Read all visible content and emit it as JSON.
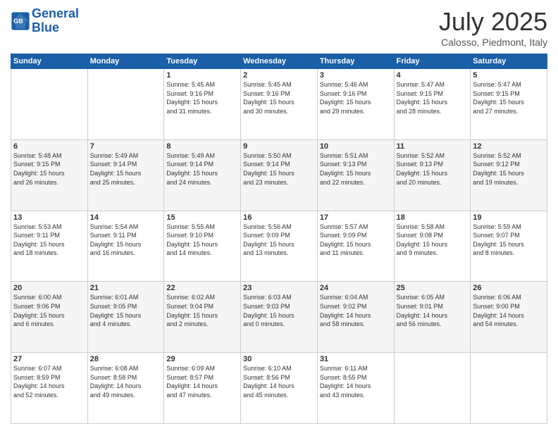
{
  "header": {
    "logo_line1": "General",
    "logo_line2": "Blue",
    "month": "July 2025",
    "location": "Calosso, Piedmont, Italy"
  },
  "weekdays": [
    "Sunday",
    "Monday",
    "Tuesday",
    "Wednesday",
    "Thursday",
    "Friday",
    "Saturday"
  ],
  "weeks": [
    [
      {
        "day": "",
        "info": ""
      },
      {
        "day": "",
        "info": ""
      },
      {
        "day": "1",
        "info": "Sunrise: 5:45 AM\nSunset: 9:16 PM\nDaylight: 15 hours\nand 31 minutes."
      },
      {
        "day": "2",
        "info": "Sunrise: 5:45 AM\nSunset: 9:16 PM\nDaylight: 15 hours\nand 30 minutes."
      },
      {
        "day": "3",
        "info": "Sunrise: 5:46 AM\nSunset: 9:16 PM\nDaylight: 15 hours\nand 29 minutes."
      },
      {
        "day": "4",
        "info": "Sunrise: 5:47 AM\nSunset: 9:15 PM\nDaylight: 15 hours\nand 28 minutes."
      },
      {
        "day": "5",
        "info": "Sunrise: 5:47 AM\nSunset: 9:15 PM\nDaylight: 15 hours\nand 27 minutes."
      }
    ],
    [
      {
        "day": "6",
        "info": "Sunrise: 5:48 AM\nSunset: 9:15 PM\nDaylight: 15 hours\nand 26 minutes."
      },
      {
        "day": "7",
        "info": "Sunrise: 5:49 AM\nSunset: 9:14 PM\nDaylight: 15 hours\nand 25 minutes."
      },
      {
        "day": "8",
        "info": "Sunrise: 5:49 AM\nSunset: 9:14 PM\nDaylight: 15 hours\nand 24 minutes."
      },
      {
        "day": "9",
        "info": "Sunrise: 5:50 AM\nSunset: 9:14 PM\nDaylight: 15 hours\nand 23 minutes."
      },
      {
        "day": "10",
        "info": "Sunrise: 5:51 AM\nSunset: 9:13 PM\nDaylight: 15 hours\nand 22 minutes."
      },
      {
        "day": "11",
        "info": "Sunrise: 5:52 AM\nSunset: 9:13 PM\nDaylight: 15 hours\nand 20 minutes."
      },
      {
        "day": "12",
        "info": "Sunrise: 5:52 AM\nSunset: 9:12 PM\nDaylight: 15 hours\nand 19 minutes."
      }
    ],
    [
      {
        "day": "13",
        "info": "Sunrise: 5:53 AM\nSunset: 9:11 PM\nDaylight: 15 hours\nand 18 minutes."
      },
      {
        "day": "14",
        "info": "Sunrise: 5:54 AM\nSunset: 9:11 PM\nDaylight: 15 hours\nand 16 minutes."
      },
      {
        "day": "15",
        "info": "Sunrise: 5:55 AM\nSunset: 9:10 PM\nDaylight: 15 hours\nand 14 minutes."
      },
      {
        "day": "16",
        "info": "Sunrise: 5:56 AM\nSunset: 9:09 PM\nDaylight: 15 hours\nand 13 minutes."
      },
      {
        "day": "17",
        "info": "Sunrise: 5:57 AM\nSunset: 9:09 PM\nDaylight: 15 hours\nand 11 minutes."
      },
      {
        "day": "18",
        "info": "Sunrise: 5:58 AM\nSunset: 9:08 PM\nDaylight: 15 hours\nand 9 minutes."
      },
      {
        "day": "19",
        "info": "Sunrise: 5:59 AM\nSunset: 9:07 PM\nDaylight: 15 hours\nand 8 minutes."
      }
    ],
    [
      {
        "day": "20",
        "info": "Sunrise: 6:00 AM\nSunset: 9:06 PM\nDaylight: 15 hours\nand 6 minutes."
      },
      {
        "day": "21",
        "info": "Sunrise: 6:01 AM\nSunset: 9:05 PM\nDaylight: 15 hours\nand 4 minutes."
      },
      {
        "day": "22",
        "info": "Sunrise: 6:02 AM\nSunset: 9:04 PM\nDaylight: 15 hours\nand 2 minutes."
      },
      {
        "day": "23",
        "info": "Sunrise: 6:03 AM\nSunset: 9:03 PM\nDaylight: 15 hours\nand 0 minutes."
      },
      {
        "day": "24",
        "info": "Sunrise: 6:04 AM\nSunset: 9:02 PM\nDaylight: 14 hours\nand 58 minutes."
      },
      {
        "day": "25",
        "info": "Sunrise: 6:05 AM\nSunset: 9:01 PM\nDaylight: 14 hours\nand 56 minutes."
      },
      {
        "day": "26",
        "info": "Sunrise: 6:06 AM\nSunset: 9:00 PM\nDaylight: 14 hours\nand 54 minutes."
      }
    ],
    [
      {
        "day": "27",
        "info": "Sunrise: 6:07 AM\nSunset: 8:59 PM\nDaylight: 14 hours\nand 52 minutes."
      },
      {
        "day": "28",
        "info": "Sunrise: 6:08 AM\nSunset: 8:58 PM\nDaylight: 14 hours\nand 49 minutes."
      },
      {
        "day": "29",
        "info": "Sunrise: 6:09 AM\nSunset: 8:57 PM\nDaylight: 14 hours\nand 47 minutes."
      },
      {
        "day": "30",
        "info": "Sunrise: 6:10 AM\nSunset: 8:56 PM\nDaylight: 14 hours\nand 45 minutes."
      },
      {
        "day": "31",
        "info": "Sunrise: 6:11 AM\nSunset: 8:55 PM\nDaylight: 14 hours\nand 43 minutes."
      },
      {
        "day": "",
        "info": ""
      },
      {
        "day": "",
        "info": ""
      }
    ]
  ]
}
